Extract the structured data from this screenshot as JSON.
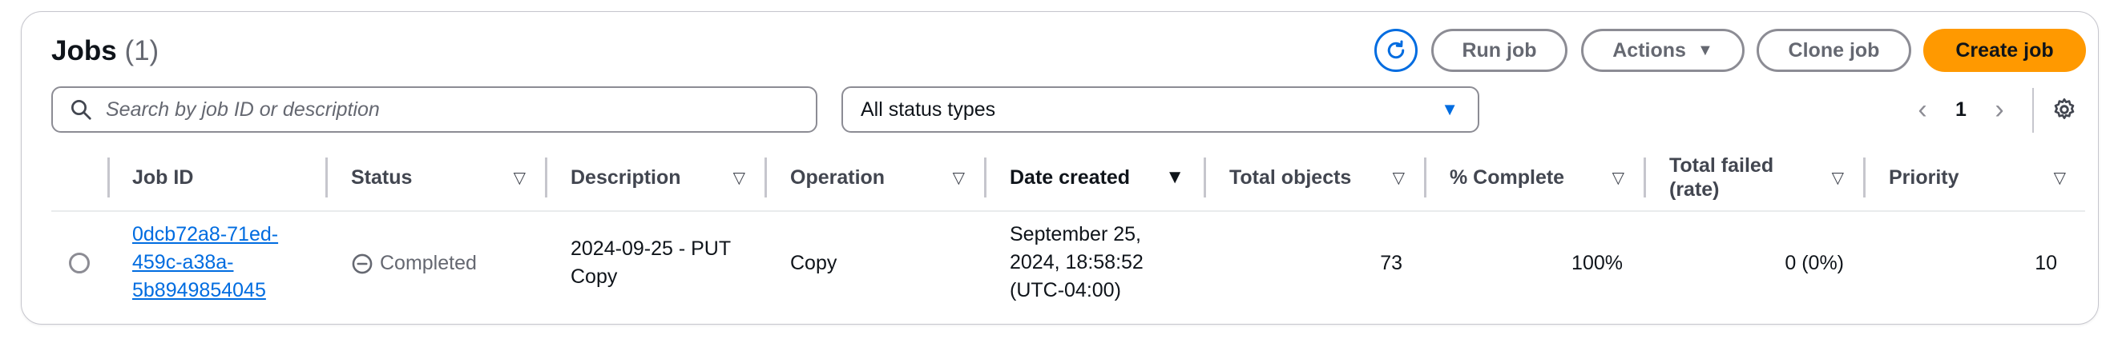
{
  "header": {
    "title": "Jobs",
    "count": "(1)",
    "refresh_icon": "refresh-icon",
    "buttons": {
      "run_job": "Run job",
      "actions": "Actions",
      "clone_job": "Clone job",
      "create_job": "Create job"
    }
  },
  "filters": {
    "search_placeholder": "Search by job ID or description",
    "status_select": "All status types"
  },
  "pagination": {
    "current_page": "1"
  },
  "table": {
    "columns": [
      "Job ID",
      "Status",
      "Description",
      "Operation",
      "Date created",
      "Total objects",
      "% Complete",
      "Total failed (rate)",
      "Priority"
    ],
    "sorted_column": "Date created",
    "rows": [
      {
        "job_id": "0dcb72a8-71ed-459c-a38a-5b8949854045",
        "status": "Completed",
        "description": "2024-09-25 - PUT Copy",
        "operation": "Copy",
        "date_created": "September 25, 2024, 18:58:52 (UTC-04:00)",
        "total_objects": "73",
        "percent_complete": "100%",
        "total_failed": "0 (0%)",
        "priority": "10"
      }
    ]
  },
  "colors": {
    "accent": "#006ce0",
    "primary_button": "#ff9900",
    "border": "#8c8c94"
  }
}
